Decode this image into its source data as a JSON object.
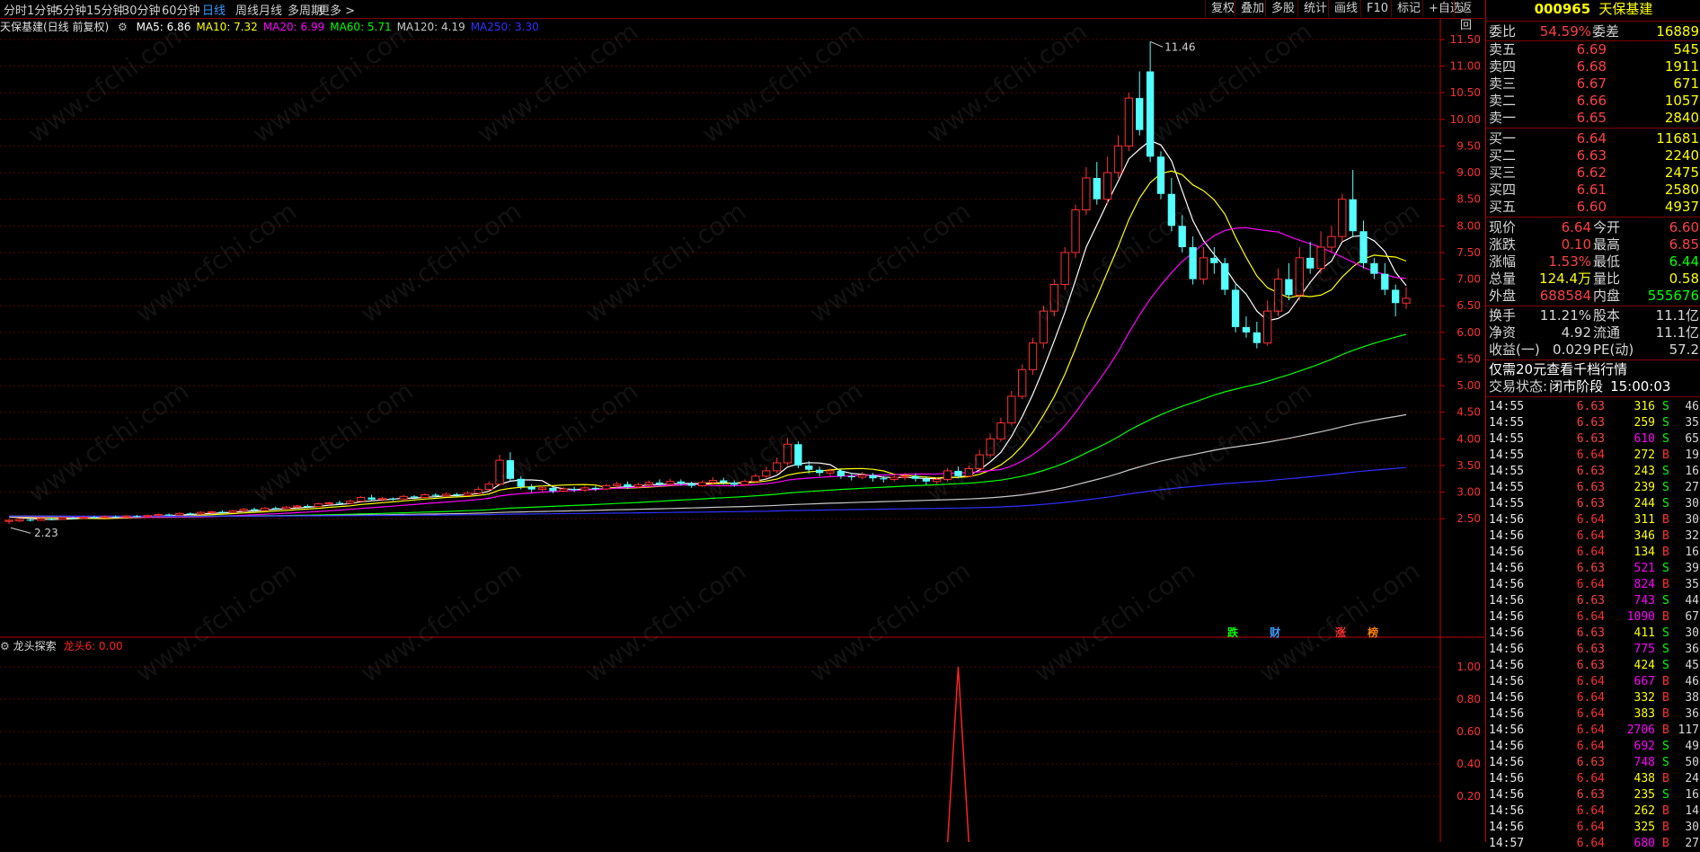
{
  "toolbar": {
    "periods": [
      "分时",
      "1分钟",
      "5分钟",
      "15分钟",
      "30分钟",
      "60分钟",
      "日线",
      "周线",
      "月线",
      "多周期",
      "更多"
    ],
    "active_period": "日线",
    "tools": [
      "复权",
      "叠加",
      "多股",
      "统计",
      "画线",
      "F10",
      "标记",
      "+自选",
      "返回"
    ]
  },
  "stock": {
    "code": "000965",
    "name": "天保基建"
  },
  "ma_line": {
    "title": "天保基建(日线 前复权)",
    "items": [
      {
        "label": "MA5: 6.86",
        "color": "#ffffff"
      },
      {
        "label": "MA10: 7.32",
        "color": "#ffff00"
      },
      {
        "label": "MA20: 6.99",
        "color": "#ff00ff"
      },
      {
        "label": "MA60: 5.71",
        "color": "#00ff00"
      },
      {
        "label": "MA120: 4.19",
        "color": "#c8c8c8"
      },
      {
        "label": "MA250: 3.30",
        "color": "#3030ff"
      }
    ]
  },
  "sub_indicator": {
    "name": "龙头探索",
    "value_label": "龙头6: 0.00"
  },
  "y_axis_main": [
    "11.50",
    "11.00",
    "10.50",
    "10.00",
    "9.50",
    "9.00",
    "8.50",
    "8.00",
    "7.50",
    "7.00",
    "6.50",
    "6.00",
    "5.50",
    "5.00",
    "4.50",
    "4.00",
    "3.50",
    "3.00",
    "2.50"
  ],
  "y_axis_sub": [
    "1.00",
    "0.80",
    "0.60",
    "0.40",
    "0.20"
  ],
  "annotations": {
    "high": "11.46",
    "low": "2.23"
  },
  "event_markers": [
    {
      "text": "跌",
      "color": "#00ff00"
    },
    {
      "text": "财",
      "color": "#3a9cff"
    },
    {
      "text": "涨",
      "color": "#ff3030"
    },
    {
      "text": "榜",
      "color": "#ff8000"
    }
  ],
  "chart_data": {
    "type": "candlestick",
    "ylim": [
      2.2,
      11.6
    ],
    "high_label": 11.46,
    "low_label": 2.23,
    "candles": [
      [
        2.45,
        2.47,
        2.4,
        2.5
      ],
      [
        2.46,
        2.49,
        2.44,
        2.51
      ],
      [
        2.48,
        2.47,
        2.45,
        2.5
      ],
      [
        2.47,
        2.5,
        2.46,
        2.52
      ],
      [
        2.5,
        2.49,
        2.47,
        2.52
      ],
      [
        2.49,
        2.52,
        2.48,
        2.54
      ],
      [
        2.52,
        2.51,
        2.49,
        2.54
      ],
      [
        2.51,
        2.53,
        2.5,
        2.55
      ],
      [
        2.53,
        2.52,
        2.5,
        2.55
      ],
      [
        2.52,
        2.54,
        2.51,
        2.56
      ],
      [
        2.54,
        2.53,
        2.51,
        2.56
      ],
      [
        2.53,
        2.55,
        2.52,
        2.57
      ],
      [
        2.55,
        2.54,
        2.52,
        2.57
      ],
      [
        2.54,
        2.56,
        2.53,
        2.58
      ],
      [
        2.56,
        2.58,
        2.54,
        2.6
      ],
      [
        2.58,
        2.57,
        2.55,
        2.6
      ],
      [
        2.57,
        2.6,
        2.56,
        2.62
      ],
      [
        2.6,
        2.59,
        2.57,
        2.62
      ],
      [
        2.59,
        2.62,
        2.58,
        2.64
      ],
      [
        2.62,
        2.63,
        2.6,
        2.65
      ],
      [
        2.63,
        2.62,
        2.6,
        2.66
      ],
      [
        2.62,
        2.65,
        2.61,
        2.67
      ],
      [
        2.65,
        2.68,
        2.63,
        2.7
      ],
      [
        2.68,
        2.66,
        2.64,
        2.71
      ],
      [
        2.66,
        2.7,
        2.65,
        2.72
      ],
      [
        2.7,
        2.69,
        2.67,
        2.73
      ],
      [
        2.69,
        2.72,
        2.68,
        2.74
      ],
      [
        2.72,
        2.74,
        2.7,
        2.76
      ],
      [
        2.74,
        2.73,
        2.71,
        2.77
      ],
      [
        2.73,
        2.78,
        2.72,
        2.8
      ],
      [
        2.78,
        2.8,
        2.75,
        2.82
      ],
      [
        2.8,
        2.79,
        2.77,
        2.84
      ],
      [
        2.79,
        2.83,
        2.78,
        2.86
      ],
      [
        2.83,
        2.9,
        2.8,
        2.93
      ],
      [
        2.9,
        2.86,
        2.83,
        2.95
      ],
      [
        2.86,
        2.88,
        2.83,
        2.91
      ],
      [
        2.88,
        2.87,
        2.84,
        2.9
      ],
      [
        2.87,
        2.92,
        2.85,
        2.95
      ],
      [
        2.92,
        2.9,
        2.87,
        2.94
      ],
      [
        2.9,
        2.95,
        2.88,
        2.98
      ],
      [
        2.95,
        2.93,
        2.9,
        2.98
      ],
      [
        2.93,
        2.96,
        2.91,
        2.99
      ],
      [
        2.96,
        2.94,
        2.91,
        2.99
      ],
      [
        2.94,
        2.98,
        2.92,
        3.02
      ],
      [
        2.98,
        3.05,
        2.96,
        3.1
      ],
      [
        3.05,
        3.15,
        3.02,
        3.2
      ],
      [
        3.15,
        3.6,
        3.12,
        3.7
      ],
      [
        3.6,
        3.25,
        3.2,
        3.75
      ],
      [
        3.25,
        3.1,
        3.05,
        3.3
      ],
      [
        3.1,
        3.05,
        3.0,
        3.15
      ],
      [
        3.05,
        3.08,
        3.0,
        3.12
      ],
      [
        3.08,
        3.02,
        2.98,
        3.12
      ],
      [
        3.02,
        3.06,
        3.0,
        3.1
      ],
      [
        3.06,
        3.04,
        3.0,
        3.1
      ],
      [
        3.04,
        3.08,
        3.01,
        3.12
      ],
      [
        3.08,
        3.06,
        3.02,
        3.12
      ],
      [
        3.06,
        3.12,
        3.04,
        3.16
      ],
      [
        3.12,
        3.15,
        3.08,
        3.2
      ],
      [
        3.15,
        3.1,
        3.06,
        3.2
      ],
      [
        3.1,
        3.14,
        3.07,
        3.18
      ],
      [
        3.14,
        3.18,
        3.1,
        3.22
      ],
      [
        3.18,
        3.15,
        3.12,
        3.24
      ],
      [
        3.15,
        3.2,
        3.12,
        3.25
      ],
      [
        3.2,
        3.16,
        3.13,
        3.24
      ],
      [
        3.16,
        3.12,
        3.08,
        3.2
      ],
      [
        3.12,
        3.18,
        3.1,
        3.22
      ],
      [
        3.18,
        3.22,
        3.14,
        3.28
      ],
      [
        3.22,
        3.18,
        3.14,
        3.27
      ],
      [
        3.18,
        3.14,
        3.1,
        3.22
      ],
      [
        3.14,
        3.2,
        3.12,
        3.24
      ],
      [
        3.2,
        3.3,
        3.16,
        3.35
      ],
      [
        3.3,
        3.4,
        3.25,
        3.48
      ],
      [
        3.4,
        3.55,
        3.35,
        3.65
      ],
      [
        3.55,
        3.9,
        3.5,
        4.02
      ],
      [
        3.9,
        3.5,
        3.45,
        3.95
      ],
      [
        3.5,
        3.42,
        3.35,
        3.58
      ],
      [
        3.42,
        3.36,
        3.3,
        3.48
      ],
      [
        3.36,
        3.4,
        3.3,
        3.45
      ],
      [
        3.4,
        3.3,
        3.25,
        3.45
      ],
      [
        3.3,
        3.28,
        3.22,
        3.36
      ],
      [
        3.28,
        3.32,
        3.24,
        3.38
      ],
      [
        3.32,
        3.26,
        3.2,
        3.36
      ],
      [
        3.26,
        3.24,
        3.18,
        3.3
      ],
      [
        3.24,
        3.28,
        3.2,
        3.33
      ],
      [
        3.28,
        3.3,
        3.22,
        3.36
      ],
      [
        3.3,
        3.25,
        3.2,
        3.35
      ],
      [
        3.25,
        3.2,
        3.14,
        3.3
      ],
      [
        3.2,
        3.24,
        3.15,
        3.28
      ],
      [
        3.24,
        3.4,
        3.2,
        3.45
      ],
      [
        3.4,
        3.3,
        3.26,
        3.48
      ],
      [
        3.3,
        3.44,
        3.28,
        3.5
      ],
      [
        3.44,
        3.7,
        3.4,
        3.8
      ],
      [
        3.7,
        4.0,
        3.65,
        4.1
      ],
      [
        4.0,
        4.3,
        3.95,
        4.4
      ],
      [
        4.3,
        4.8,
        4.25,
        4.9
      ],
      [
        4.8,
        5.3,
        4.75,
        5.4
      ],
      [
        5.3,
        5.8,
        5.2,
        5.9
      ],
      [
        5.8,
        6.4,
        5.7,
        6.5
      ],
      [
        6.4,
        6.9,
        6.3,
        7.0
      ],
      [
        6.9,
        7.5,
        6.8,
        7.6
      ],
      [
        7.5,
        8.3,
        7.4,
        8.4
      ],
      [
        8.3,
        8.9,
        8.2,
        9.1
      ],
      [
        8.9,
        8.5,
        8.4,
        9.2
      ],
      [
        8.5,
        9.0,
        8.4,
        9.3
      ],
      [
        9.0,
        9.5,
        8.9,
        9.7
      ],
      [
        9.5,
        10.4,
        9.4,
        10.5
      ],
      [
        10.4,
        9.8,
        9.7,
        10.9
      ],
      [
        10.9,
        9.3,
        9.2,
        11.46
      ],
      [
        9.3,
        8.6,
        8.5,
        9.4
      ],
      [
        8.6,
        8.0,
        7.9,
        8.9
      ],
      [
        8.0,
        7.6,
        7.5,
        8.2
      ],
      [
        7.6,
        7.0,
        6.9,
        7.8
      ],
      [
        7.0,
        7.4,
        6.9,
        7.6
      ],
      [
        7.4,
        7.3,
        7.1,
        7.6
      ],
      [
        7.3,
        6.8,
        6.7,
        7.4
      ],
      [
        6.8,
        6.1,
        6.0,
        6.9
      ],
      [
        6.1,
        6.0,
        5.9,
        6.3
      ],
      [
        6.0,
        5.8,
        5.7,
        6.2
      ],
      [
        5.8,
        6.4,
        5.75,
        6.6
      ],
      [
        6.4,
        7.0,
        6.3,
        7.2
      ],
      [
        7.0,
        6.7,
        6.6,
        7.3
      ],
      [
        6.7,
        7.4,
        6.6,
        7.6
      ],
      [
        7.4,
        7.2,
        7.1,
        7.7
      ],
      [
        7.2,
        7.6,
        7.1,
        7.9
      ],
      [
        7.6,
        7.8,
        7.5,
        8.0
      ],
      [
        7.8,
        8.5,
        7.7,
        8.6
      ],
      [
        8.5,
        7.9,
        7.8,
        9.05
      ],
      [
        7.9,
        7.3,
        7.2,
        8.1
      ],
      [
        7.3,
        7.1,
        7.0,
        7.4
      ],
      [
        7.1,
        6.8,
        6.7,
        7.3
      ],
      [
        6.8,
        6.55,
        6.3,
        6.9
      ],
      [
        6.55,
        6.64,
        6.44,
        6.85
      ]
    ],
    "sub_indicator_peak": {
      "name": "龙头6",
      "value": 1.0,
      "at_candle": 89
    }
  },
  "quote": {
    "weibi": {
      "label": "委比",
      "value": "54.59%",
      "label2": "委差",
      "value2": "16889"
    },
    "asks": [
      {
        "label": "卖五",
        "price": "6.69",
        "vol": "545"
      },
      {
        "label": "卖四",
        "price": "6.68",
        "vol": "1911"
      },
      {
        "label": "卖三",
        "price": "6.67",
        "vol": "671"
      },
      {
        "label": "卖二",
        "price": "6.66",
        "vol": "1057"
      },
      {
        "label": "卖一",
        "price": "6.65",
        "vol": "2840"
      }
    ],
    "bids": [
      {
        "label": "买一",
        "price": "6.64",
        "vol": "11681"
      },
      {
        "label": "买二",
        "price": "6.63",
        "vol": "2240"
      },
      {
        "label": "买三",
        "price": "6.62",
        "vol": "2475"
      },
      {
        "label": "买四",
        "price": "6.61",
        "vol": "2580"
      },
      {
        "label": "买五",
        "price": "6.60",
        "vol": "4937"
      }
    ],
    "stats": [
      {
        "l1": "现价",
        "v1": "6.64",
        "c1": "#ff4040",
        "l2": "今开",
        "v2": "6.60",
        "c2": "#ff4040"
      },
      {
        "l1": "涨跌",
        "v1": "0.10",
        "c1": "#ff4040",
        "l2": "最高",
        "v2": "6.85",
        "c2": "#ff4040"
      },
      {
        "l1": "涨幅",
        "v1": "1.53%",
        "c1": "#ff4040",
        "l2": "最低",
        "v2": "6.44",
        "c2": "#00ff00"
      },
      {
        "l1": "总量",
        "v1": "124.4万",
        "c1": "#ffff00",
        "l2": "量比",
        "v2": "0.58",
        "c2": "#ffff00"
      },
      {
        "l1": "外盘",
        "v1": "688584",
        "c1": "#ff4040",
        "l2": "内盘",
        "v2": "555676",
        "c2": "#00ff00"
      },
      {
        "l1": "换手",
        "v1": "11.21%",
        "c1": "#d8d8d8",
        "l2": "股本",
        "v2": "11.1亿",
        "c2": "#d8d8d8"
      },
      {
        "l1": "净资",
        "v1": "4.92",
        "c1": "#d8d8d8",
        "l2": "流通",
        "v2": "11.1亿",
        "c2": "#d8d8d8"
      },
      {
        "l1": "收益(一)",
        "v1": "0.029",
        "c1": "#d8d8d8",
        "l2": "PE(动)",
        "v2": "57.2",
        "c2": "#d8d8d8"
      }
    ],
    "promo": "仅需20元查看千档行情",
    "status_label": "交易状态:",
    "status_value": "闭市阶段",
    "status_time": "15:00:03"
  },
  "ticks": [
    [
      "14:55",
      "6.63",
      "316",
      "S",
      "46"
    ],
    [
      "14:55",
      "6.63",
      "259",
      "S",
      "35"
    ],
    [
      "14:55",
      "6.63",
      "610",
      "S",
      "65"
    ],
    [
      "14:55",
      "6.64",
      "272",
      "B",
      "19"
    ],
    [
      "14:55",
      "6.63",
      "243",
      "S",
      "16"
    ],
    [
      "14:55",
      "6.63",
      "239",
      "S",
      "27"
    ],
    [
      "14:55",
      "6.63",
      "244",
      "S",
      "30"
    ],
    [
      "14:56",
      "6.64",
      "311",
      "B",
      "30"
    ],
    [
      "14:56",
      "6.64",
      "346",
      "B",
      "32"
    ],
    [
      "14:56",
      "6.64",
      "134",
      "B",
      "16"
    ],
    [
      "14:56",
      "6.63",
      "521",
      "S",
      "39"
    ],
    [
      "14:56",
      "6.64",
      "824",
      "B",
      "35"
    ],
    [
      "14:56",
      "6.63",
      "743",
      "S",
      "44"
    ],
    [
      "14:56",
      "6.64",
      "1090",
      "B",
      "67"
    ],
    [
      "14:56",
      "6.63",
      "411",
      "S",
      "30"
    ],
    [
      "14:56",
      "6.63",
      "775",
      "S",
      "36"
    ],
    [
      "14:56",
      "6.63",
      "424",
      "S",
      "45"
    ],
    [
      "14:56",
      "6.64",
      "667",
      "B",
      "46"
    ],
    [
      "14:56",
      "6.64",
      "332",
      "B",
      "38"
    ],
    [
      "14:56",
      "6.64",
      "383",
      "B",
      "36"
    ],
    [
      "14:56",
      "6.64",
      "2706",
      "B",
      "117"
    ],
    [
      "14:56",
      "6.64",
      "692",
      "S",
      "49"
    ],
    [
      "14:56",
      "6.63",
      "748",
      "S",
      "50"
    ],
    [
      "14:56",
      "6.64",
      "438",
      "B",
      "24"
    ],
    [
      "14:56",
      "6.63",
      "235",
      "S",
      "16"
    ],
    [
      "14:56",
      "6.64",
      "262",
      "B",
      "14"
    ],
    [
      "14:56",
      "6.64",
      "325",
      "B",
      "30"
    ],
    [
      "14:57",
      "6.64",
      "680",
      "B",
      "27"
    ]
  ]
}
